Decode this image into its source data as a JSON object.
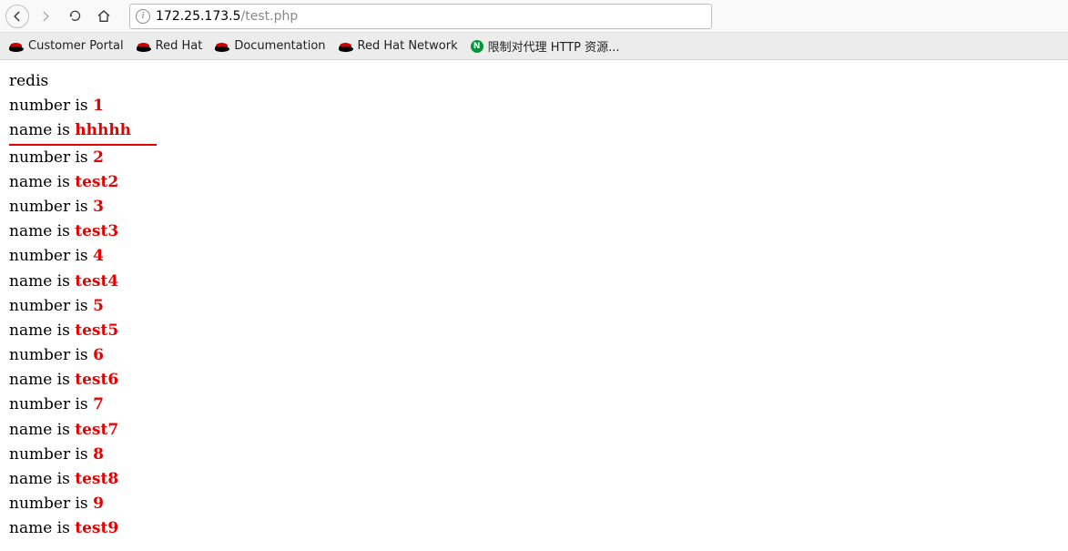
{
  "toolbar": {
    "url_host": "172.25.173.5",
    "url_path": "/test.php",
    "info_icon_label": "i"
  },
  "bookmarks": [
    {
      "name": "customer-portal",
      "label": "Customer Portal",
      "icon": "redhat"
    },
    {
      "name": "red-hat",
      "label": "Red Hat",
      "icon": "redhat"
    },
    {
      "name": "documentation",
      "label": "Documentation",
      "icon": "redhat"
    },
    {
      "name": "red-hat-network",
      "label": "Red Hat Network",
      "icon": "redhat"
    },
    {
      "name": "nginx-proxy",
      "label": "限制对代理 HTTP 资源...",
      "icon": "nginx",
      "icon_letter": "N"
    }
  ],
  "page": {
    "title": "redis",
    "number_prefix": "number is ",
    "name_prefix": "name is ",
    "rows": [
      {
        "number": "1",
        "name": "hhhhh",
        "underline": true
      },
      {
        "number": "2",
        "name": "test2"
      },
      {
        "number": "3",
        "name": "test3"
      },
      {
        "number": "4",
        "name": "test4"
      },
      {
        "number": "5",
        "name": "test5"
      },
      {
        "number": "6",
        "name": "test6"
      },
      {
        "number": "7",
        "name": "test7"
      },
      {
        "number": "8",
        "name": "test8"
      },
      {
        "number": "9",
        "name": "test9"
      }
    ]
  }
}
